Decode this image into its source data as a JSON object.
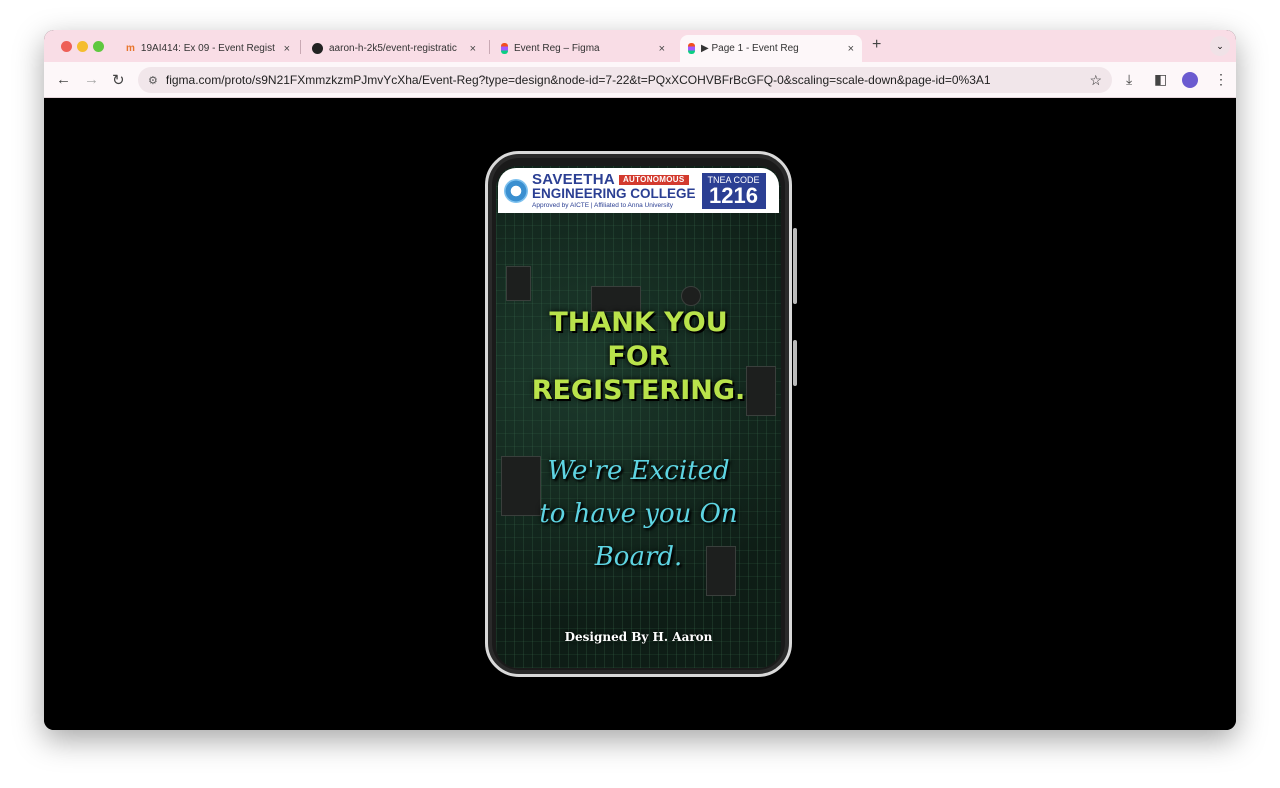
{
  "browser": {
    "tabs": [
      {
        "label": "19AI414: Ex 09 - Event Regist",
        "icon": "moodle-icon"
      },
      {
        "label": "aaron-h-2k5/event-registratic",
        "icon": "github-icon"
      },
      {
        "label": "Event Reg – Figma",
        "icon": "figma-icon"
      },
      {
        "label": "▶ Page 1 - Event Reg",
        "icon": "figma-icon",
        "active": true
      }
    ],
    "close_glyph": "×",
    "new_tab": "+",
    "url": "figma.com/proto/s9N21FXmmzkzmPJmvYcXha/Event-Reg?type=design&node-id=7-22&t=PQxXCOHVBFrBcGFQ-0&scaling=scale-down&page-id=0%3A1"
  },
  "header": {
    "college_line1": "SAVEETHA",
    "badge": "AUTONOMOUS",
    "college_line2": "ENGINEERING COLLEGE",
    "subline": "Approved by AICTE | Affiliated to Anna University",
    "tnea_label": "TNEA CODE",
    "tnea_code": "1216"
  },
  "message": {
    "thanks": [
      "THANK YOU",
      "FOR",
      "REGISTERING."
    ],
    "excited": [
      "We're Excited",
      "to have you On",
      "Board."
    ],
    "credit": "Designed By H. Aaron"
  },
  "colors": {
    "thanks": "#b9e34b",
    "excited": "#5ed4e2",
    "tabbar": "#f9dde6"
  }
}
